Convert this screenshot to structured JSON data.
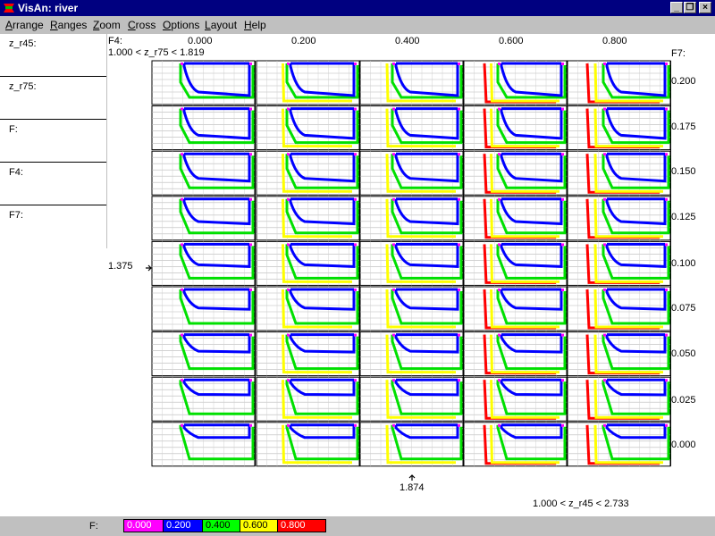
{
  "window": {
    "title": "VisAn: river"
  },
  "menu": [
    "Arrange",
    "Ranges",
    "Zoom",
    "Cross",
    "Options",
    "Layout",
    "Help"
  ],
  "side_panel": {
    "fields": [
      {
        "label": "z_r45:"
      },
      {
        "label": "z_r75:"
      },
      {
        "label": "F:"
      },
      {
        "label": "F4:"
      },
      {
        "label": "F7:"
      }
    ]
  },
  "plot": {
    "x_axis_name": "F4:",
    "x_ticks": [
      "0.000",
      "0.200",
      "0.400",
      "0.600",
      "0.800"
    ],
    "y_axis_name": "F7:",
    "y_ticks": [
      "0.200",
      "0.175",
      "0.150",
      "0.125",
      "0.100",
      "0.075",
      "0.050",
      "0.025",
      "0.000"
    ],
    "range_z_r75": "1.000 < z_r75 < 1.819",
    "range_z_r45": "1.000 < z_r45 < 2.733",
    "marker_z_r75": "1.375",
    "marker_z_r45": "1.874"
  },
  "legend": {
    "label": "F:",
    "items": [
      {
        "value": "0.000",
        "color": "#ff00ff"
      },
      {
        "value": "0.200",
        "color": "#0000ff"
      },
      {
        "value": "0.400",
        "color": "#00ff00"
      },
      {
        "value": "0.600",
        "color": "#ffff00"
      },
      {
        "value": "0.800",
        "color": "#ff0000"
      }
    ]
  },
  "colors": {
    "titlebar": "#000080",
    "series_blue": "#0000ff",
    "series_green": "#00e000",
    "series_yellow": "#ffff00",
    "series_red": "#ff0000",
    "series_magenta": "#ff00ff"
  }
}
